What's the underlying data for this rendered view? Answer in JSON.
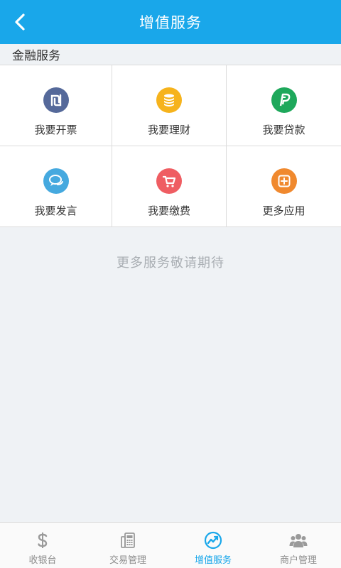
{
  "header": {
    "title": "增值服务"
  },
  "section": {
    "label": "金融服务"
  },
  "services": [
    {
      "label": "我要开票",
      "icon": "invoice-icon",
      "color": "#55699a"
    },
    {
      "label": "我要理财",
      "icon": "coins-icon",
      "color": "#f6b31c"
    },
    {
      "label": "我要贷款",
      "icon": "paypal-icon",
      "color": "#1ea85b"
    },
    {
      "label": "我要发言",
      "icon": "chat-icon",
      "color": "#45a9df"
    },
    {
      "label": "我要缴费",
      "icon": "cart-icon",
      "color": "#ef5d62"
    },
    {
      "label": "更多应用",
      "icon": "plus-box-icon",
      "color": "#f0892e"
    }
  ],
  "more_text": "更多服务敬请期待",
  "tabs": [
    {
      "label": "收银台",
      "icon": "dollar-icon",
      "active": false
    },
    {
      "label": "交易管理",
      "icon": "pos-terminal-icon",
      "active": false
    },
    {
      "label": "增值服务",
      "icon": "trend-chart-icon",
      "active": true
    },
    {
      "label": "商户管理",
      "icon": "users-icon",
      "active": false
    }
  ],
  "colors": {
    "brand": "#19a7ea",
    "background": "#eff2f5",
    "tab_inactive": "#8c8c8c"
  }
}
